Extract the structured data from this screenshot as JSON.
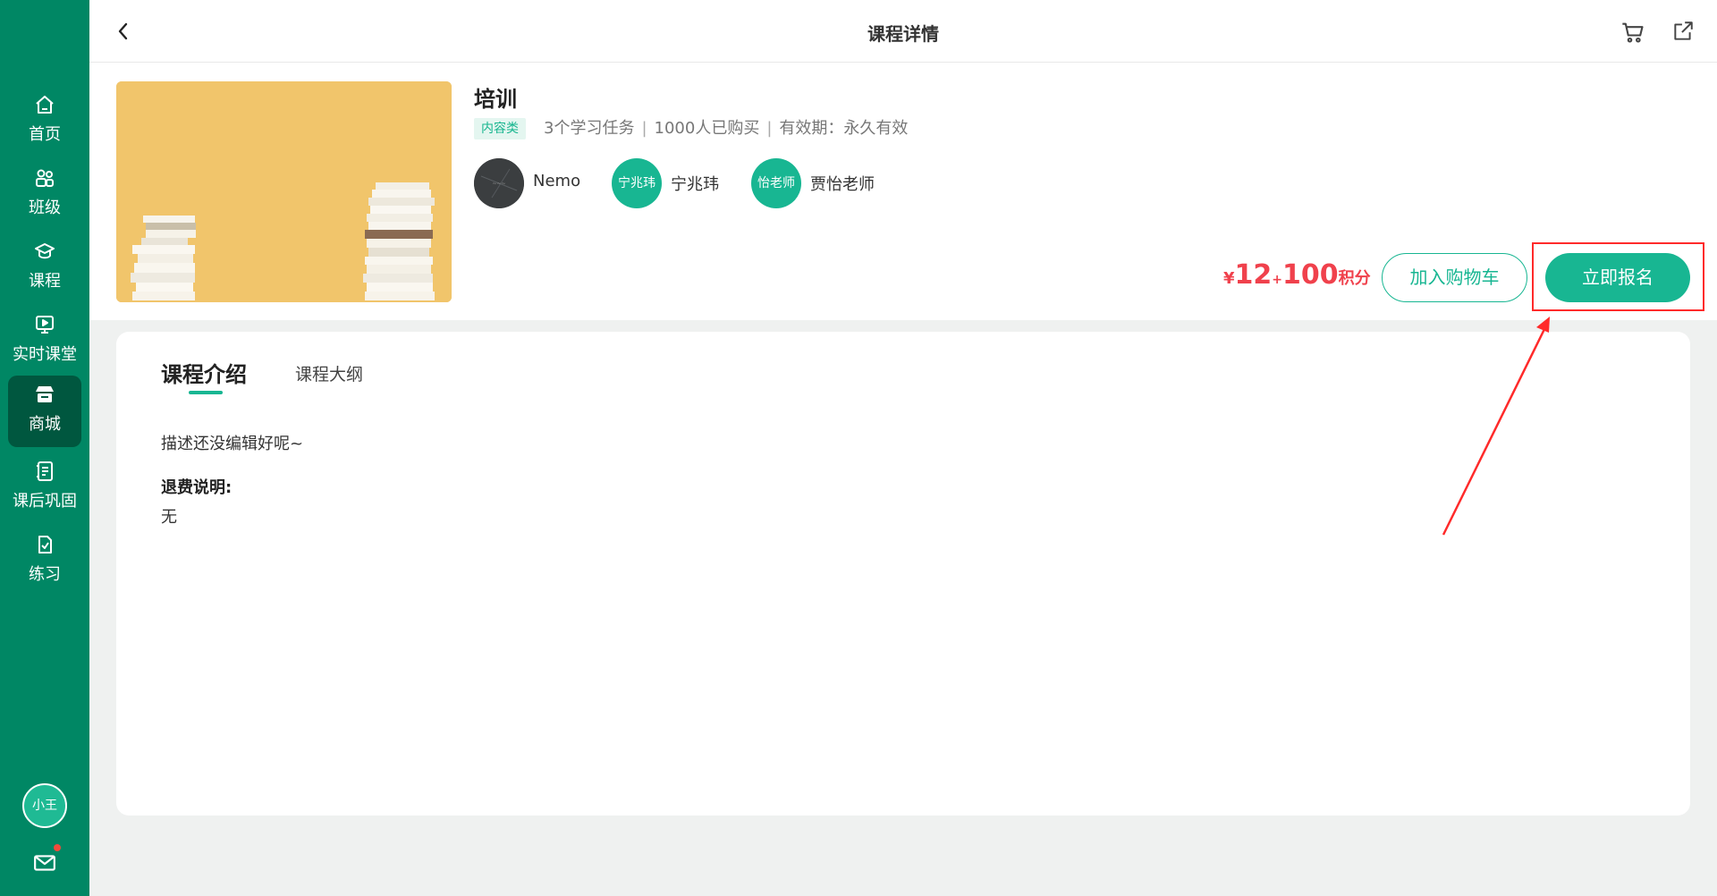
{
  "sidebar": {
    "items": [
      {
        "label": "首页",
        "icon": "home-icon"
      },
      {
        "label": "班级",
        "icon": "class-icon"
      },
      {
        "label": "课程",
        "icon": "graduation-cap-icon"
      },
      {
        "label": "实时课堂",
        "icon": "live-screen-icon"
      },
      {
        "label": "商城",
        "icon": "shop-icon",
        "active": true
      },
      {
        "label": "课后巩固",
        "icon": "review-list-icon"
      },
      {
        "label": "练习",
        "icon": "exercise-icon"
      }
    ],
    "user_avatar": "小王",
    "mail_icon": "mail-icon"
  },
  "topbar": {
    "title": "课程详情",
    "back_icon": "chevron-left-icon",
    "cart_icon": "cart-icon",
    "share_icon": "external-link-icon"
  },
  "course": {
    "title": "培训",
    "type_tag": "内容类",
    "tasks": "3个学习任务",
    "buyers": "1000人已购买",
    "validity": "有效期：永久有效",
    "teachers": [
      {
        "name": "Nemo",
        "avatar_text": ""
      },
      {
        "name": "宁兆玮",
        "avatar_text": "宁兆玮"
      },
      {
        "name": "贾怡老师",
        "avatar_text": "怡老师"
      }
    ],
    "price": {
      "currency": "¥",
      "amount": "12",
      "plus": "+",
      "points": "100",
      "points_unit": "积分"
    },
    "add_cart_label": "加入购物车",
    "enroll_label": "立即报名"
  },
  "tabs": {
    "intro": "课程介绍",
    "outline": "课程大纲"
  },
  "content": {
    "description": "描述还没编辑好呢~",
    "refund_label": "退费说明:",
    "refund_value": "无"
  },
  "colors": {
    "sidebar": "#008764",
    "sidebar_active": "#00573f",
    "accent": "#18b692",
    "price": "#f0414c",
    "annotation": "#ff2a2a"
  }
}
